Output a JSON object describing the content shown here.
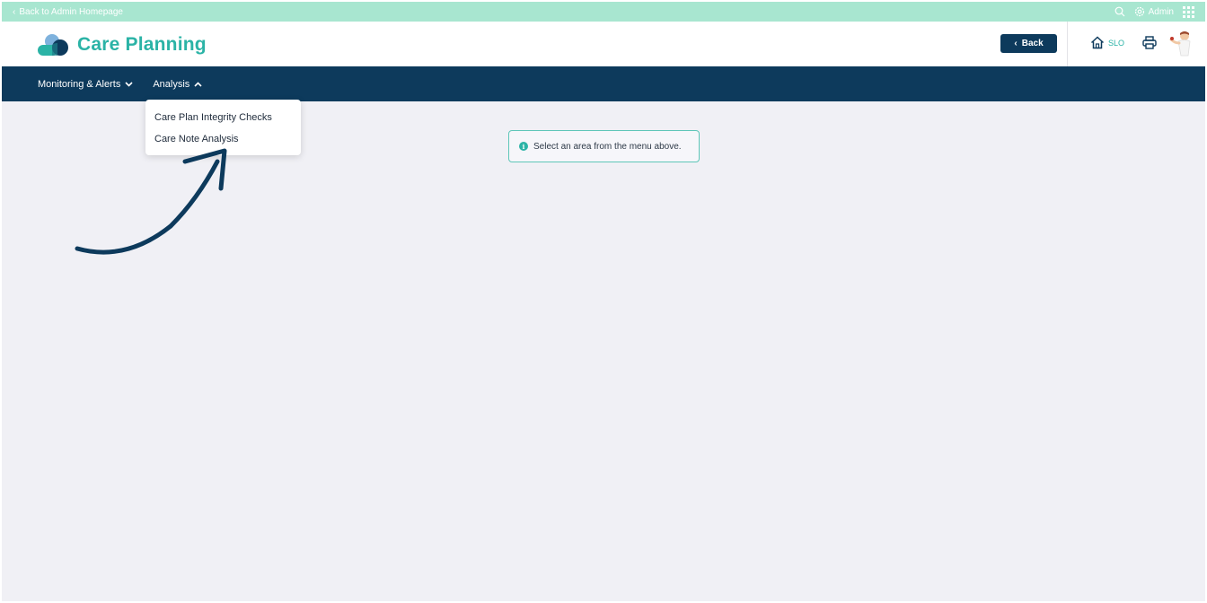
{
  "top_bar": {
    "back_link": "Back to Admin Homepage",
    "admin_label": "Admin",
    "icons": [
      "search-icon",
      "gear-icon",
      "apps-grid-icon"
    ]
  },
  "header": {
    "title": "Care Planning",
    "back_button": "Back",
    "home_label": "SLO",
    "icons": [
      "logo-icon",
      "home-icon",
      "print-icon",
      "avatar"
    ]
  },
  "nav": {
    "items": [
      {
        "label": "Monitoring & Alerts",
        "state": "collapsed"
      },
      {
        "label": "Analysis",
        "state": "expanded"
      }
    ]
  },
  "dropdown": {
    "items": [
      {
        "label": "Care Plan Integrity Checks"
      },
      {
        "label": "Care Note Analysis"
      }
    ]
  },
  "notice": {
    "text": "Select an area from the menu above."
  },
  "colors": {
    "brand_teal": "#2bb3a6",
    "navy": "#0d3a5c",
    "mint": "#a8e6d0",
    "background": "#f0f0f5"
  }
}
